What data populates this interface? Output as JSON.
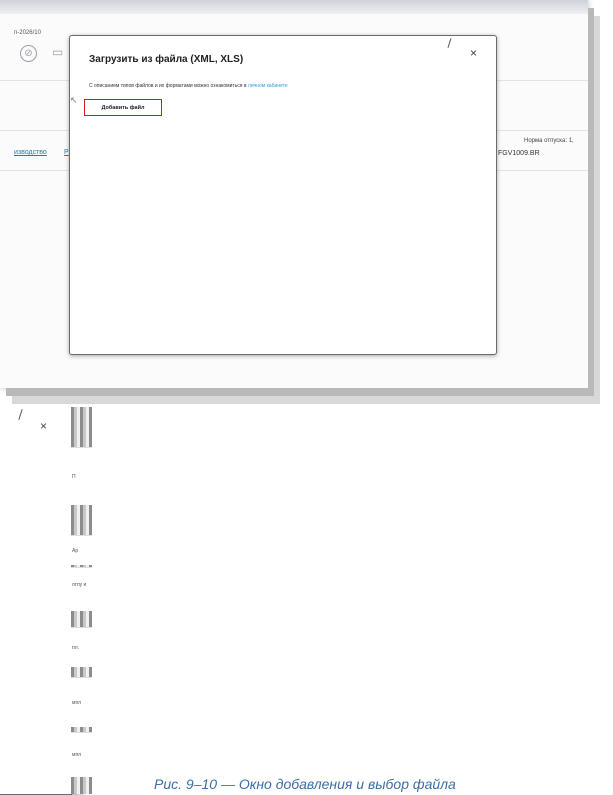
{
  "background": {
    "doc_id": "п-2026/10",
    "link1": "изводство",
    "link2": "Р",
    "norma": "Норма отпуска: 1,",
    "code": "FGV1009.BR"
  },
  "modal": {
    "title": "Загрузить из файла (XML, XLS)",
    "desc_prefix": "С описанием типов файлов и их форматами можно ознакомиться в ",
    "desc_link": "личном кабинете",
    "add_button": "Добавить файл",
    "close_symbol": "×"
  },
  "second_shot": {
    "close_symbol": "×",
    "partial_cells": [
      "П",
      "Ар",
      "отпу\nи",
      "пл.",
      "мпл",
      "мпл"
    ]
  },
  "caption": "Рис. 9–10 — Окно добавления и выбор файла",
  "colors": {
    "link": "#2b9fd6",
    "highlight": "#d31c1c",
    "caption": "#3a6fa8"
  }
}
